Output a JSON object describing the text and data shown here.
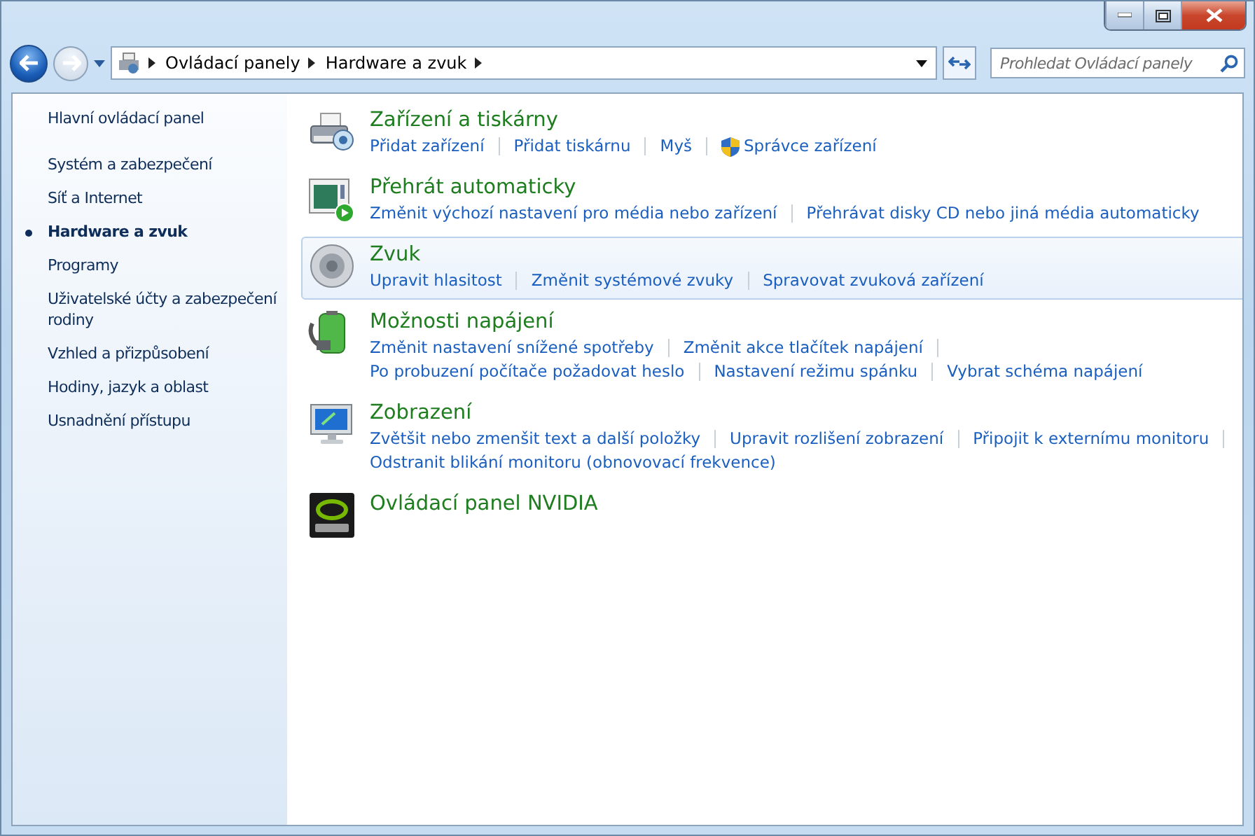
{
  "address": {
    "crumbs": [
      "Ovládací panely",
      "Hardware a zvuk"
    ]
  },
  "search": {
    "placeholder": "Prohledat Ovládací panely"
  },
  "sidebar": {
    "items": [
      {
        "label": "Hlavní ovládací panel",
        "selected": false,
        "kind": "home"
      },
      {
        "label": "Systém a zabezpečení",
        "selected": false,
        "kind": "link"
      },
      {
        "label": "Síť a Internet",
        "selected": false,
        "kind": "link"
      },
      {
        "label": "Hardware a zvuk",
        "selected": true,
        "kind": "link"
      },
      {
        "label": "Programy",
        "selected": false,
        "kind": "link"
      },
      {
        "label": "Uživatelské účty a zabezpečení rodiny",
        "selected": false,
        "kind": "link"
      },
      {
        "label": "Vzhled a přizpůsobení",
        "selected": false,
        "kind": "link"
      },
      {
        "label": "Hodiny, jazyk a oblast",
        "selected": false,
        "kind": "link"
      },
      {
        "label": "Usnadnění přístupu",
        "selected": false,
        "kind": "link"
      }
    ]
  },
  "categories": [
    {
      "kind": "printer",
      "title": "Zařízení a tiskárny",
      "selected": false,
      "lines": [
        [
          {
            "label": "Přidat zařízení"
          },
          {
            "label": "Přidat tiskárnu"
          },
          {
            "label": "Myš"
          },
          {
            "label": "Správce zařízení",
            "shield": true
          }
        ]
      ]
    },
    {
      "kind": "autoplay",
      "title": "Přehrát automaticky",
      "selected": false,
      "lines": [
        [
          {
            "label": "Změnit výchozí nastavení pro média nebo zařízení"
          },
          {
            "label": "Přehrávat disky CD nebo jiná média automaticky"
          }
        ]
      ]
    },
    {
      "kind": "speaker",
      "title": "Zvuk",
      "selected": true,
      "lines": [
        [
          {
            "label": "Upravit hlasitost"
          },
          {
            "label": "Změnit systémové zvuky"
          },
          {
            "label": "Spravovat zvuková zařízení"
          }
        ]
      ]
    },
    {
      "kind": "power",
      "title": "Možnosti napájení",
      "selected": false,
      "lines": [
        [
          {
            "label": "Změnit nastavení snížené spotřeby"
          },
          {
            "label": "Změnit akce tlačítek napájení"
          }
        ],
        [
          {
            "label": "Po probuzení počítače požadovat heslo"
          },
          {
            "label": "Nastavení režimu spánku"
          },
          {
            "label": "Vybrat schéma napájení"
          }
        ]
      ]
    },
    {
      "kind": "display",
      "title": "Zobrazení",
      "selected": false,
      "lines": [
        [
          {
            "label": "Zvětšit nebo zmenšit text a další položky"
          },
          {
            "label": "Upravit rozlišení zobrazení"
          },
          {
            "label": "Připojit k externímu monitoru"
          }
        ],
        [
          {
            "label": "Odstranit blikání monitoru (obnovovací frekvence)"
          }
        ]
      ]
    },
    {
      "kind": "nvidia",
      "title": "Ovládací panel NVIDIA",
      "selected": false
    }
  ]
}
